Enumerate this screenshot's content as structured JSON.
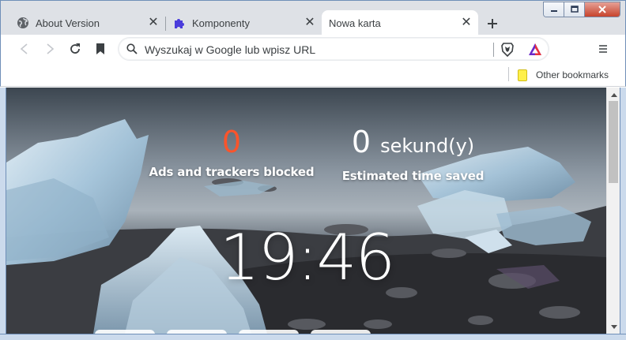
{
  "tabs": [
    {
      "title": "About Version",
      "icon": "globe-icon",
      "active": false
    },
    {
      "title": "Komponenty",
      "icon": "puzzle-icon",
      "active": false
    },
    {
      "title": "Nowa karta",
      "icon": "",
      "active": true
    }
  ],
  "toolbar": {
    "omnibox_placeholder": "Wyszukaj w Google lub wpisz URL"
  },
  "bookmarks": {
    "other_label": "Other bookmarks"
  },
  "stats": {
    "ads_count": "0",
    "ads_label": "Ads and trackers blocked",
    "time_count": "0",
    "time_unit": "sekund(y)",
    "time_label": "Estimated time saved"
  },
  "clock": "19:46",
  "colors": {
    "brave_orange": "#fb542b",
    "tab_strip": "#dee1e6",
    "puzzle_icon": "#4a3cdb"
  }
}
